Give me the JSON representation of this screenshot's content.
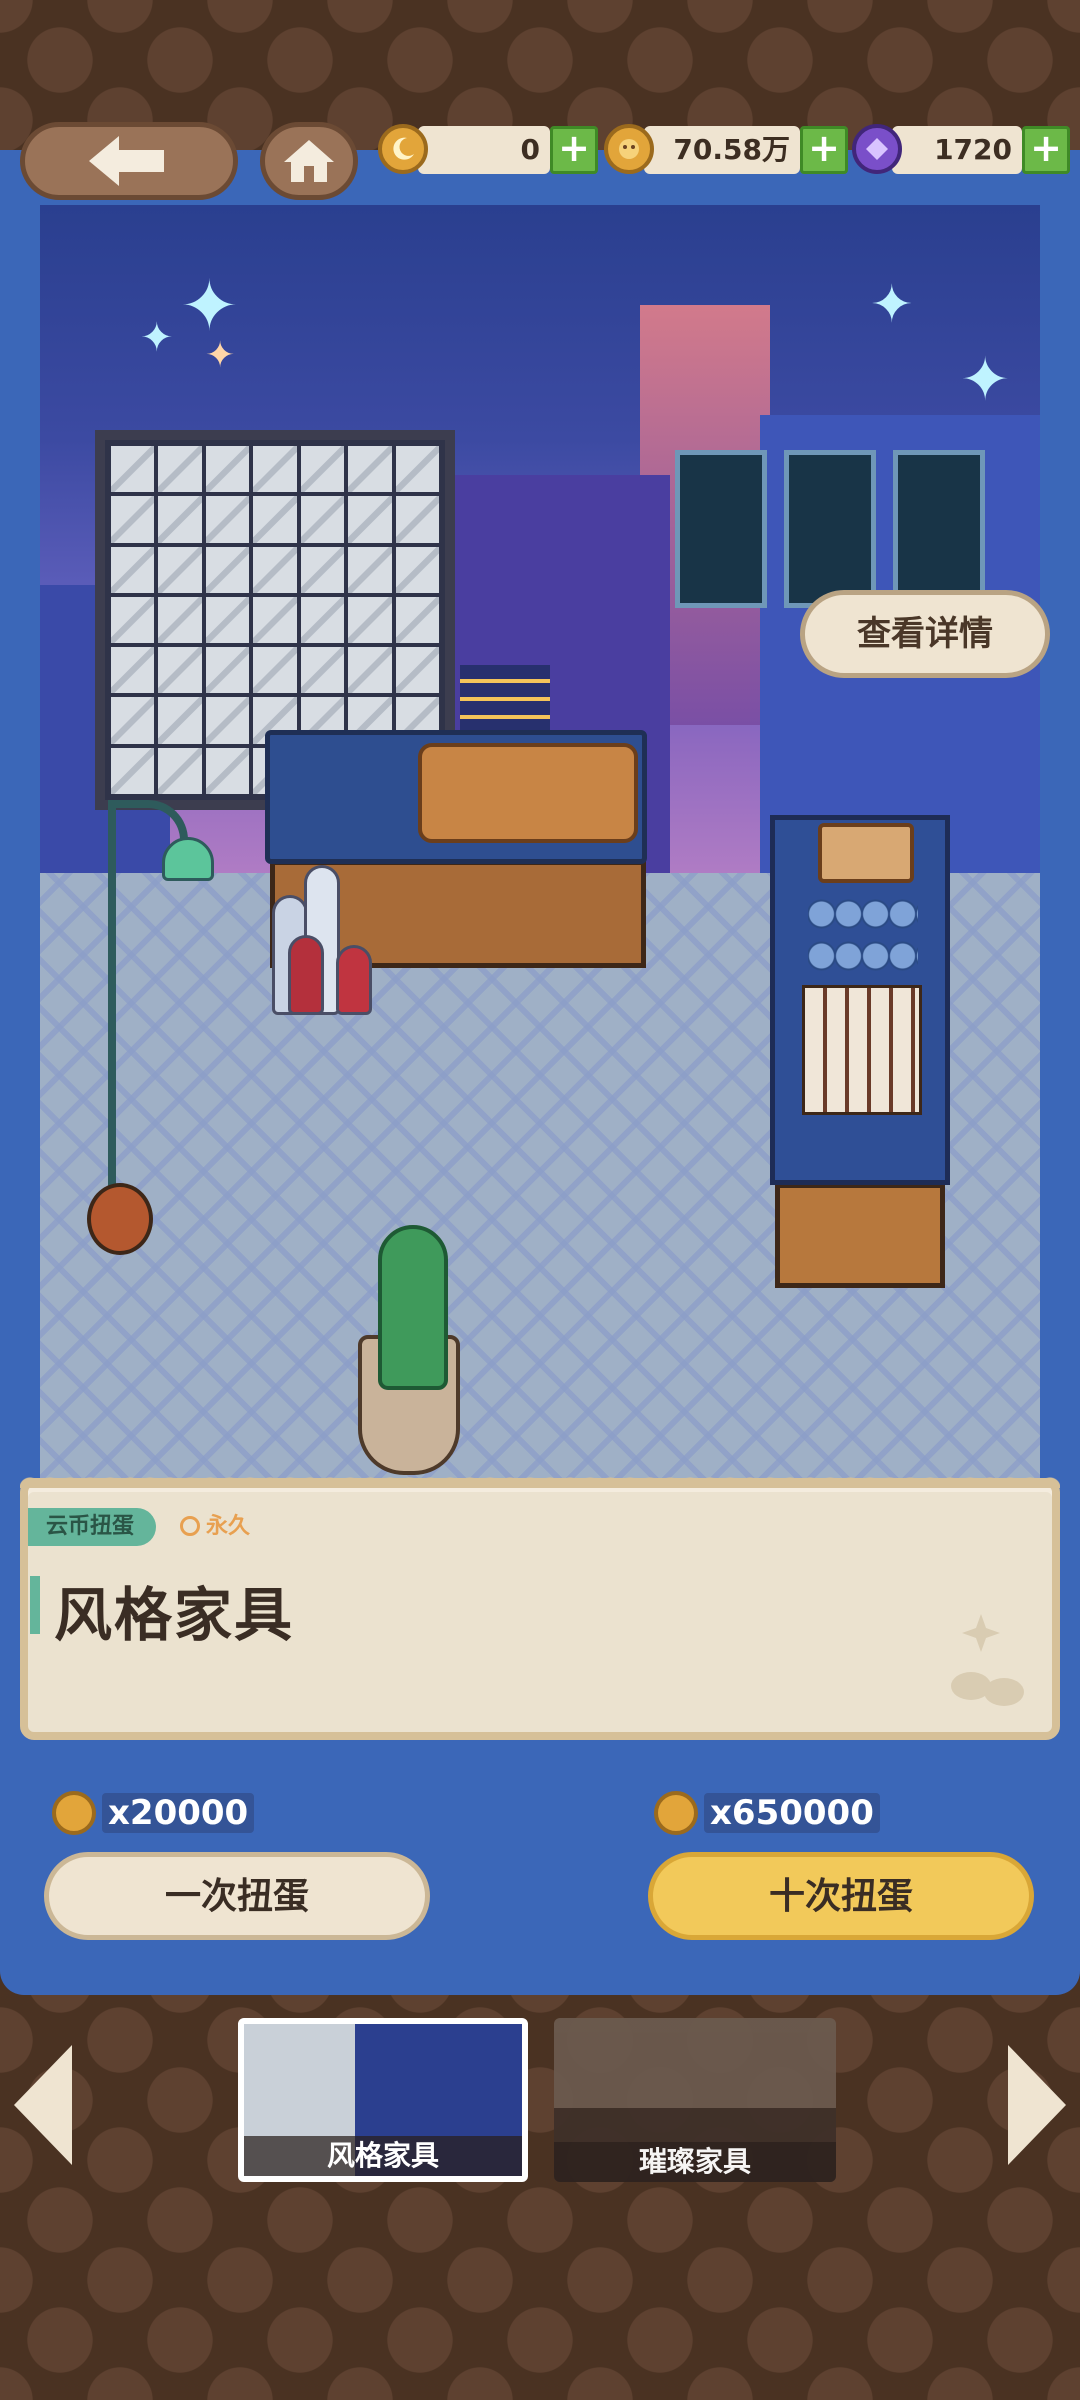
{
  "topbar": {
    "currencies": [
      {
        "name": "moon-coin",
        "value": "0"
      },
      {
        "name": "cloud-coin",
        "value": "70.58万"
      },
      {
        "name": "gem",
        "value": "1720"
      }
    ],
    "plus_symbol": "+"
  },
  "scene": {
    "detail_button": "查看详情"
  },
  "card": {
    "tag": "云币扭蛋",
    "duration": "永久",
    "title": "风格家具"
  },
  "pulls": {
    "single": {
      "cost": "x20000",
      "label": "一次扭蛋"
    },
    "ten": {
      "cost": "x650000",
      "label": "十次扭蛋"
    }
  },
  "selector": {
    "items": [
      {
        "label": "风格家具",
        "selected": true
      },
      {
        "label": "璀璨家具",
        "selected": false
      }
    ]
  },
  "colors": {
    "panel_blue": "#3b67b8",
    "coin_gold": "#e2a53a",
    "plus_green": "#6cb948",
    "accent_teal": "#64b59b",
    "ten_pull_yellow": "#f2c95a",
    "background_brown": "#4a3222"
  }
}
